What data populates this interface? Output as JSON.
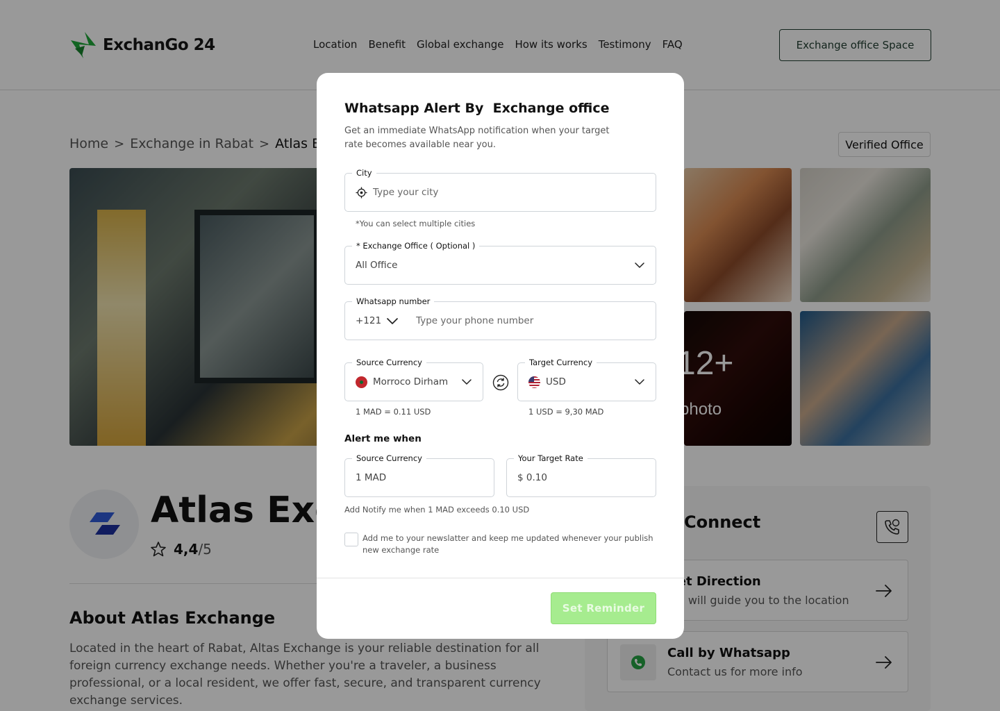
{
  "header": {
    "logo_text": "ExchanGo 24",
    "nav": [
      "Location",
      "Benefit",
      "Global exchange",
      "How its works",
      "Testimony",
      "FAQ"
    ],
    "cta_label": "Exchange office Space"
  },
  "breadcrumb": {
    "items": [
      "Home",
      "Exchange in Rabat",
      "Atlas Exchange"
    ],
    "separator": ">"
  },
  "verified_label": "Verified Office",
  "gallery": {
    "more_count": "12+",
    "more_label": "photo"
  },
  "office": {
    "name": "Atlas Exchange",
    "rating_value": "4,4",
    "rating_max": "/5"
  },
  "about": {
    "title": "About Atlas Exchange",
    "text": "Located in the heart of Rabat, Altas Exchange is your reliable destination for all foreign currency exchange needs. Whether you're a traveler, a business professional, or a local resident, we offer fast, secure, and transparent currency exchange services."
  },
  "connect": {
    "title": "Connect",
    "cards": [
      {
        "title": "Get Direction",
        "subtitle": "We will guide you to the location"
      },
      {
        "title": "Call by Whatsapp",
        "subtitle": "Contact us for more info"
      }
    ]
  },
  "modal": {
    "title": "Whatsapp Alert By  Exchange office",
    "description": "Get an immediate WhatsApp notification when your target rate becomes available near you.",
    "city": {
      "label": "City",
      "placeholder": "Type your city",
      "note": "*You can select multiple cities"
    },
    "office": {
      "label": "* Exchange Office ( Optional )",
      "value": "All Office"
    },
    "phone": {
      "label": "Whatsapp number",
      "code": "+121",
      "placeholder": "Type your phone number"
    },
    "source_currency": {
      "label": "Source Currency",
      "value": "Morroco Dirham",
      "rate": "1 MAD = 0.11 USD"
    },
    "target_currency": {
      "label": "Target Currency",
      "value": "USD",
      "rate": "1 USD = 9,30 MAD"
    },
    "alert": {
      "title": "Alert me when",
      "amount_label": "Source Currency",
      "amount_value": "1 MAD",
      "target_label": "Your Target Rate",
      "target_value": "$ 0.10",
      "note": "Add Notify me when 1 MAD exceeds 0.10 USD"
    },
    "newsletter_label": "Add me to your newslatter and keep me updated whenever your publish new exchange rate",
    "submit_label": "Set Reminder"
  },
  "colors": {
    "brand_green": "#1fa83a",
    "button_green": "#a6ec8f",
    "dark_green": "#1f3d2f",
    "overlay": "rgba(0,0,0,0.40)"
  }
}
